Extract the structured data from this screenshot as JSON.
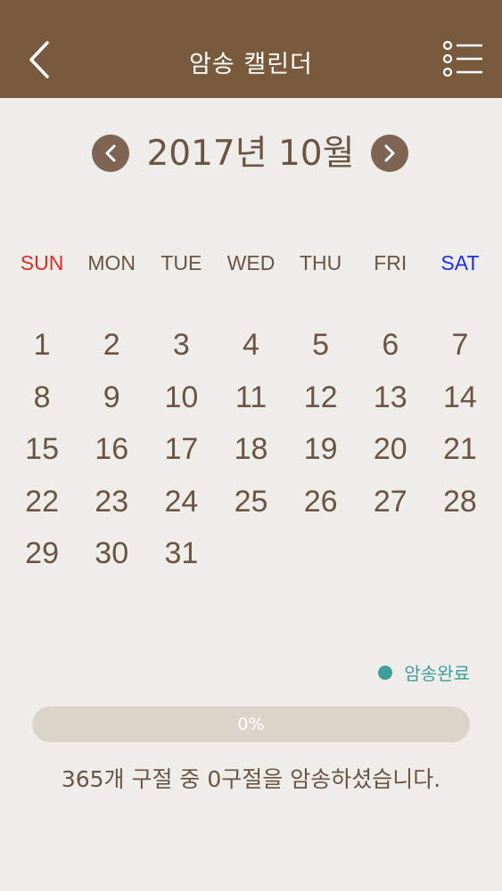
{
  "header": {
    "title": "암송 캘린더",
    "back_icon": "chevron-left-icon",
    "menu_icon": "list-icon"
  },
  "calendar": {
    "month_title": "2017년 10월",
    "weekdays": [
      "SUN",
      "MON",
      "TUE",
      "WED",
      "THU",
      "FRI",
      "SAT"
    ],
    "first_weekday_index": 0,
    "days": [
      "1",
      "2",
      "3",
      "4",
      "5",
      "6",
      "7",
      "8",
      "9",
      "10",
      "11",
      "12",
      "13",
      "14",
      "15",
      "16",
      "17",
      "18",
      "19",
      "20",
      "21",
      "22",
      "23",
      "24",
      "25",
      "26",
      "27",
      "28",
      "29",
      "30",
      "31"
    ]
  },
  "legend": {
    "label": "암송완료",
    "color": "#3e9e9a"
  },
  "progress": {
    "percent": 0,
    "label": "0%"
  },
  "summary": "365개 구절 중 0구절을 암송하셨습니다.",
  "colors": {
    "header_bg": "#7a5a3d",
    "text_brown": "#6b5444",
    "sunday": "#e02a22",
    "saturday": "#1d2ee8",
    "accent": "#3e9e9a"
  }
}
